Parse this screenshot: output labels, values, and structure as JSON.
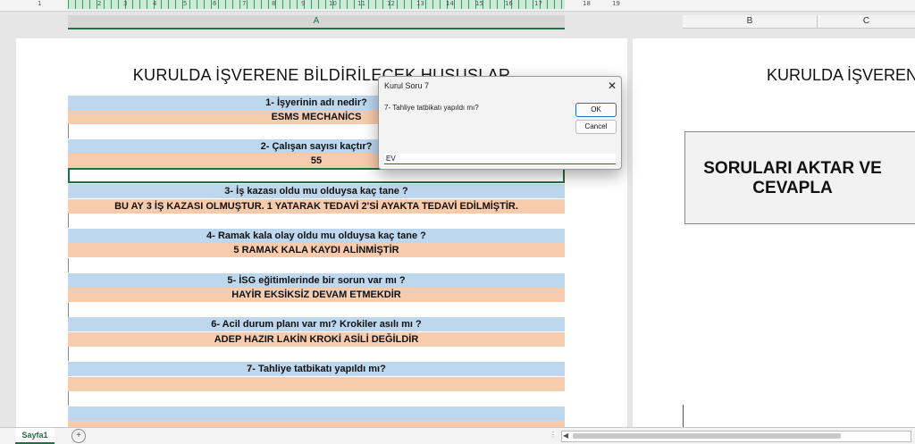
{
  "ruler": {
    "numbers": [
      "1",
      "2",
      "3",
      "4",
      "5",
      "6",
      "7",
      "8",
      "9",
      "10",
      "11",
      "12",
      "13",
      "14",
      "15",
      "16",
      "17",
      "18",
      "19"
    ]
  },
  "columns": {
    "a": "A",
    "b": "B",
    "c": "C"
  },
  "sheet": {
    "title": "KURULDA İŞVERENE BİLDİRİLECEK HUSUSLAR",
    "rows": [
      {
        "question": "1- İşyerinin adı nedir?",
        "answer": "ESMS MECHANİCS"
      },
      {
        "question": "2- Çalışan sayısı kaçtır?",
        "answer": "55"
      },
      {
        "question": "3- İş kazası oldu mu olduysa kaç tane ?",
        "answer": "BU AY 3 İŞ KAZASI OLMUŞTUR. 1 YATARAK TEDAVİ 2'Sİ AYAKTA TEDAVİ EDİLMİŞTİR."
      },
      {
        "question": "4- Ramak kala olay oldu mu olduysa kaç tane ?",
        "answer": "5 RAMAK KALA KAYDI ALİNMİŞTİR"
      },
      {
        "question": "5- İSG eğitimlerinde bir sorun var mı ?",
        "answer": "HAYİR EKSİKSİZ DEVAM ETMEKDİR"
      },
      {
        "question": "6- Acil durum planı var mı? Krokiler asılı mı ?",
        "answer": "ADEP HAZIR LAKİN KROKİ ASİLİ DEĞİLDİR"
      },
      {
        "question": "7- Tahliye tatbikatı yapıldı mı?",
        "answer": ""
      }
    ]
  },
  "page2": {
    "title": "KURULDA İŞVERENE",
    "button_label": "SORULARI AKTAR VE\nCEVAPLA"
  },
  "dialog": {
    "title": "Kurul Soru 7",
    "prompt": "7- Tahliye tatbikatı yapıldı mı?",
    "ok_label": "OK",
    "cancel_label": "Cancel",
    "input_value": "EV"
  },
  "bottom": {
    "sheet_tab": "Sayfa1",
    "add_icon": "+"
  },
  "colors": {
    "question_bg": "#bdd7ee",
    "answer_bg": "#f8cbad",
    "accent": "#1e7145"
  }
}
